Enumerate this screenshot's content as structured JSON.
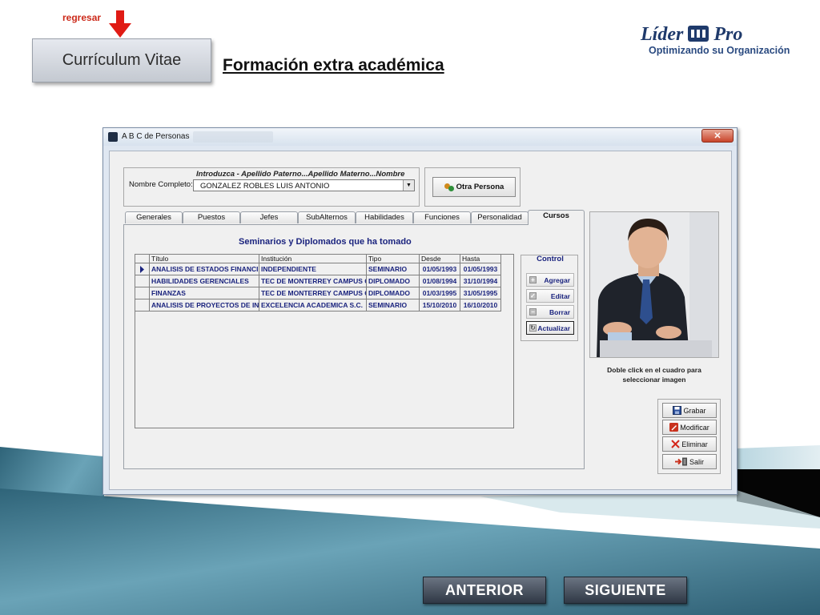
{
  "slide": {
    "back_link": "regresar",
    "cv_button": "Currículum Vitae",
    "title": "Formación extra académica",
    "logo_name_left": "Líder",
    "logo_name_right": "Pro",
    "logo_tagline": "Optimizando su Organización"
  },
  "window": {
    "title": "A B C de Personas",
    "close_glyph": "✕",
    "name_hint": "Introduzca - Apellido Paterno...Apellido Materno...Nombre",
    "name_label": "Nombre Completo:",
    "name_value": "GONZALEZ ROBLES LUIS ANTONIO",
    "otra_persona": "Otra Persona",
    "tabs": [
      "Generales",
      "Puestos",
      "Jefes",
      "SubAlternos",
      "Habilidades",
      "Funciones",
      "Personalidad",
      "Cursos"
    ],
    "active_tab": "Cursos",
    "grid_title": "Seminarios y Diplomados que ha tomado",
    "columns": [
      "Título",
      "Institución",
      "Tipo",
      "Desde",
      "Hasta"
    ],
    "rows": [
      [
        "ANALISIS DE ESTADOS FINANCIEROS",
        "INDEPENDIENTE",
        "SEMINARIO",
        "01/05/1993",
        "01/05/1993"
      ],
      [
        "HABILIDADES GERENCIALES",
        "TEC DE MONTERREY CAMPUS OBREGON",
        "DIPLOMADO",
        "01/08/1994",
        "31/10/1994"
      ],
      [
        "FINANZAS",
        "TEC DE MONTERREY CAMPUS CD",
        "DIPLOMADO",
        "01/03/1995",
        "31/05/1995"
      ],
      [
        "ANALISIS DE PROYECTOS DE INVERSION",
        "EXCELENCIA ACADEMICA S.C.",
        "SEMINARIO",
        "15/10/2010",
        "16/10/2010"
      ]
    ],
    "control": {
      "label": "Control",
      "agregar": "Agregar",
      "editar": "Editar",
      "borrar": "Borrar",
      "actualizar": "Actualizar"
    },
    "photo_caption_1": "Doble click en el cuadro para",
    "photo_caption_2": "seleccionar imagen",
    "actions": {
      "grabar": "Grabar",
      "modificar": "Modificar",
      "eliminar": "Eliminar",
      "salir": "Salir"
    }
  },
  "nav": {
    "anterior": "ANTERIOR",
    "siguiente": "SIGUIENTE"
  },
  "colors": {
    "accent_red": "#cc2a1a",
    "grid_text": "#1a237e",
    "teal_band": "#3d6f84"
  }
}
